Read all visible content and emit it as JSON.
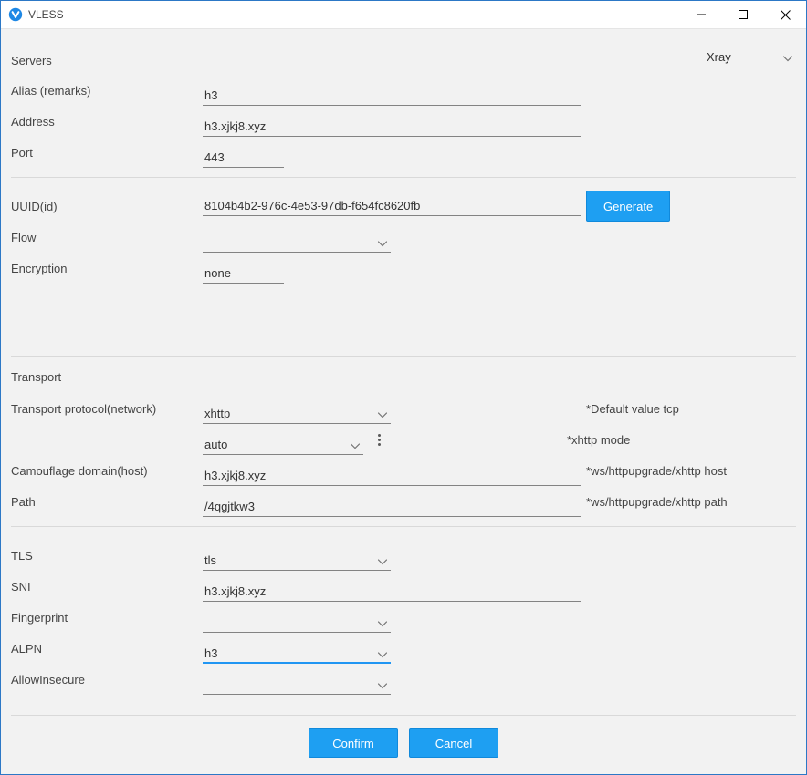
{
  "window": {
    "title": "VLESS"
  },
  "servers": {
    "heading": "Servers",
    "engine": "Xray"
  },
  "fields": {
    "alias_label": "Alias (remarks)",
    "alias_value": "h3",
    "address_label": "Address",
    "address_value": "h3.xjkj8.xyz",
    "port_label": "Port",
    "port_value": "443",
    "uuid_label": "UUID(id)",
    "uuid_value": "8104b4b2-976c-4e53-97db-f654fc8620fb",
    "generate_label": "Generate",
    "flow_label": "Flow",
    "flow_value": "",
    "encryption_label": "Encryption",
    "encryption_value": "none"
  },
  "transport": {
    "heading": "Transport",
    "protocol_label": "Transport protocol(network)",
    "protocol_value": "xhttp",
    "protocol_hint": "*Default value tcp",
    "mode_value": "auto",
    "mode_hint": "*xhttp mode",
    "host_label": "Camouflage domain(host)",
    "host_value": "h3.xjkj8.xyz",
    "host_hint": "*ws/httpupgrade/xhttp host",
    "path_label": "Path",
    "path_value": "/4qgjtkw3",
    "path_hint": "*ws/httpupgrade/xhttp path"
  },
  "tls": {
    "tls_label": "TLS",
    "tls_value": "tls",
    "sni_label": "SNI",
    "sni_value": "h3.xjkj8.xyz",
    "fingerprint_label": "Fingerprint",
    "fingerprint_value": "",
    "alpn_label": "ALPN",
    "alpn_value": "h3",
    "allowinsecure_label": "AllowInsecure",
    "allowinsecure_value": ""
  },
  "buttons": {
    "confirm": "Confirm",
    "cancel": "Cancel"
  }
}
